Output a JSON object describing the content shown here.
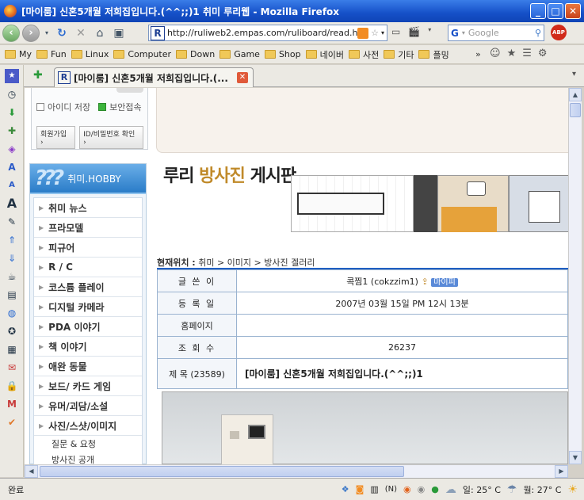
{
  "window": {
    "title": "[마이룸] 신혼5개월 저희집입니다.(^^;;)1 취미 루리웹 - Mozilla Firefox"
  },
  "nav": {
    "url": "http://ruliweb2.empas.com/ruliboard/read.h",
    "search_placeholder": "Google",
    "abp_label": "ABP"
  },
  "bookmarks": [
    "My",
    "Fun",
    "Linux",
    "Computer",
    "Down",
    "Game",
    "Shop",
    "네이버",
    "사전",
    "기타",
    "플밍"
  ],
  "tab": {
    "title": "[마이룸] 신혼5개월 저희집입니다.(..."
  },
  "login": {
    "save_id": "아이디 저장",
    "secure": "보안접속",
    "join": "회원가입",
    "find": "ID/비밀번호 확인"
  },
  "hobby": {
    "header": "취미.HOBBY",
    "items": [
      "취미 뉴스",
      "프라모델",
      "피규어",
      "R / C",
      "코스튬 플레이",
      "디지털 카메라",
      "PDA 이야기",
      "책 이야기",
      "애완 동물",
      "보드/ 카드 게임",
      "유머/괴담/소설",
      "사진/스샷/이미지"
    ],
    "subitems": [
      "질문 & 요청",
      "방사진 공개"
    ]
  },
  "board": {
    "title_a": "루리",
    "title_b": "방사진",
    "title_c": "게시판"
  },
  "breadcrumb": {
    "label": "현재위치 :",
    "path": "취미 > 이미지 > 방사진 겔러리"
  },
  "post": {
    "author_label": "글 쓴 이",
    "author": "콕찜1 (cokzzim1)",
    "mypi": "마이피",
    "date_label": "등 록 일",
    "date": "2007년 03월 15일 PM 12시 13분",
    "home_label": "홈페이지",
    "home": "",
    "views_label": "조 회 수",
    "views": "26237",
    "subject_label": "제  목 (23589)",
    "subject": "[마이룸] 신혼5개월 저희집입니다.(^^;;)1"
  },
  "status": {
    "done": "완료",
    "weather1": "일: 25° C",
    "weather2": "월: 27° C",
    "n": "(N)"
  },
  "colors": {
    "accent": "#1f5fc2",
    "hobby": "#2a7cc8",
    "brown": "#c08a2a"
  }
}
